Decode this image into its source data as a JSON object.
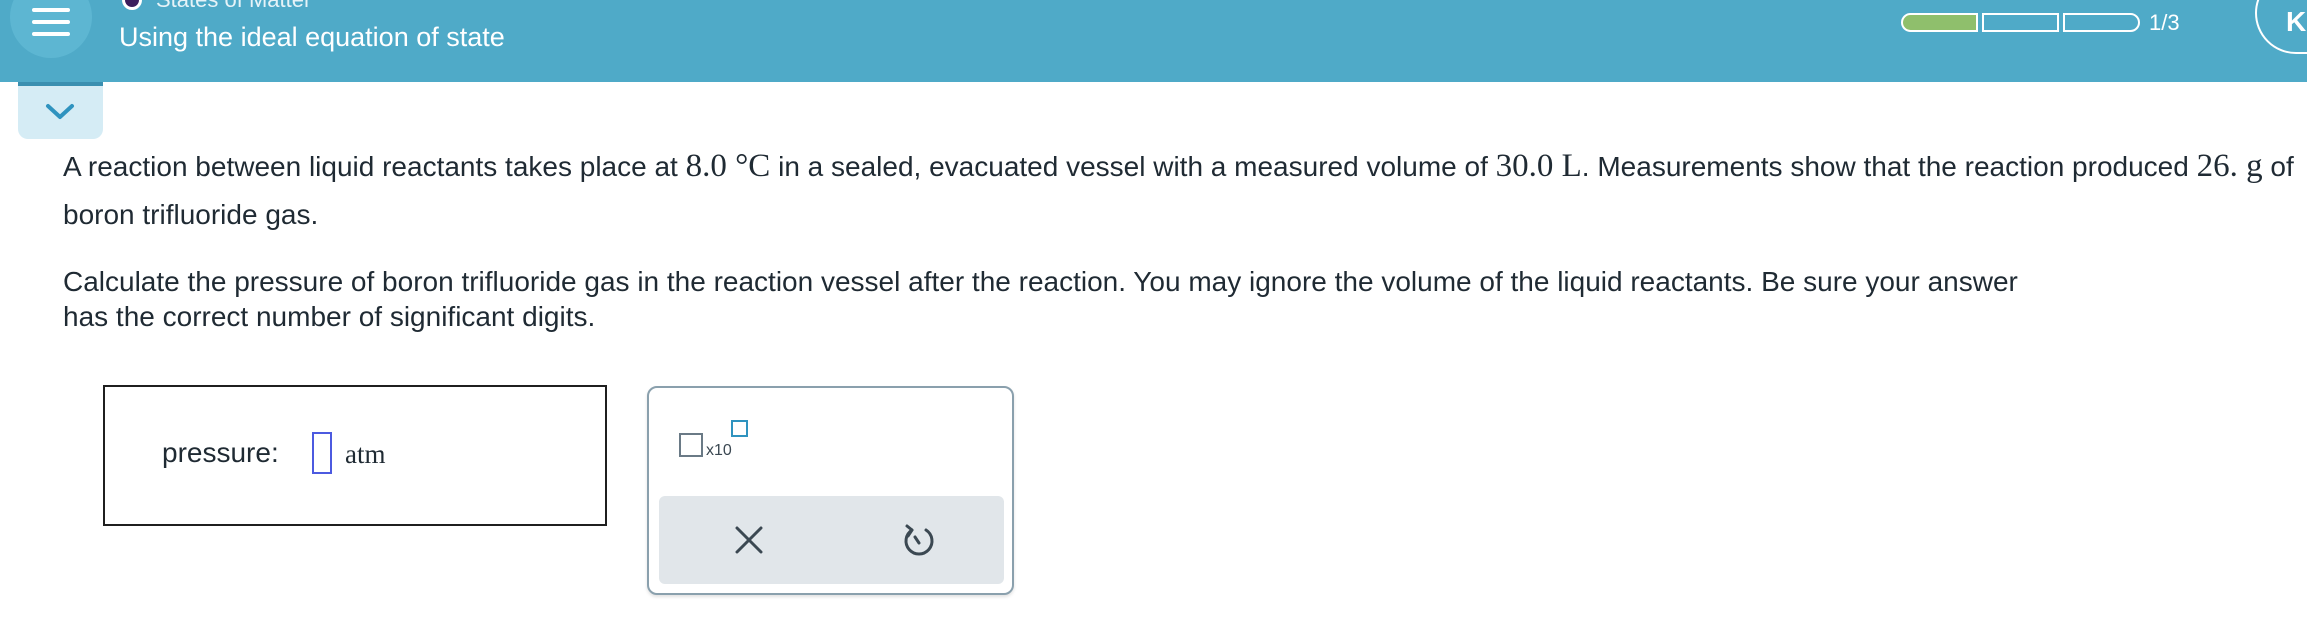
{
  "header": {
    "topic": "States of Matter",
    "title": "Using the ideal equation of state",
    "progress": {
      "completed": 1,
      "total": 3,
      "label": "1/3"
    },
    "user_initial": "K"
  },
  "question": {
    "p1": {
      "t1": "A reaction between liquid reactants takes place at ",
      "m1": "8.0 °C",
      "t2": " in a sealed, evacuated vessel with a measured volume of ",
      "m2": "30.0 L",
      "t3": ". Measurements show that the reaction produced ",
      "m3": "26. g",
      "t4": " of boron trifluoride gas."
    },
    "p2": {
      "line1": "Calculate the pressure of boron trifluoride gas in the reaction vessel after the reaction. You may ignore the volume of the liquid reactants. Be sure your answer",
      "line2": "has the correct number of significant digits."
    }
  },
  "answer": {
    "label": "pressure:",
    "value": "",
    "unit": "atm"
  },
  "tools": {
    "sci_notation_label": "x10"
  },
  "colors": {
    "header_bg": "#4faac8",
    "progress_fill": "#8fbf6c",
    "input_border": "#4c5ae0",
    "accent": "#2f93bf"
  },
  "icons": [
    "menu-icon",
    "topic-dot-icon",
    "chevron-down-icon",
    "close-icon",
    "undo-icon"
  ]
}
